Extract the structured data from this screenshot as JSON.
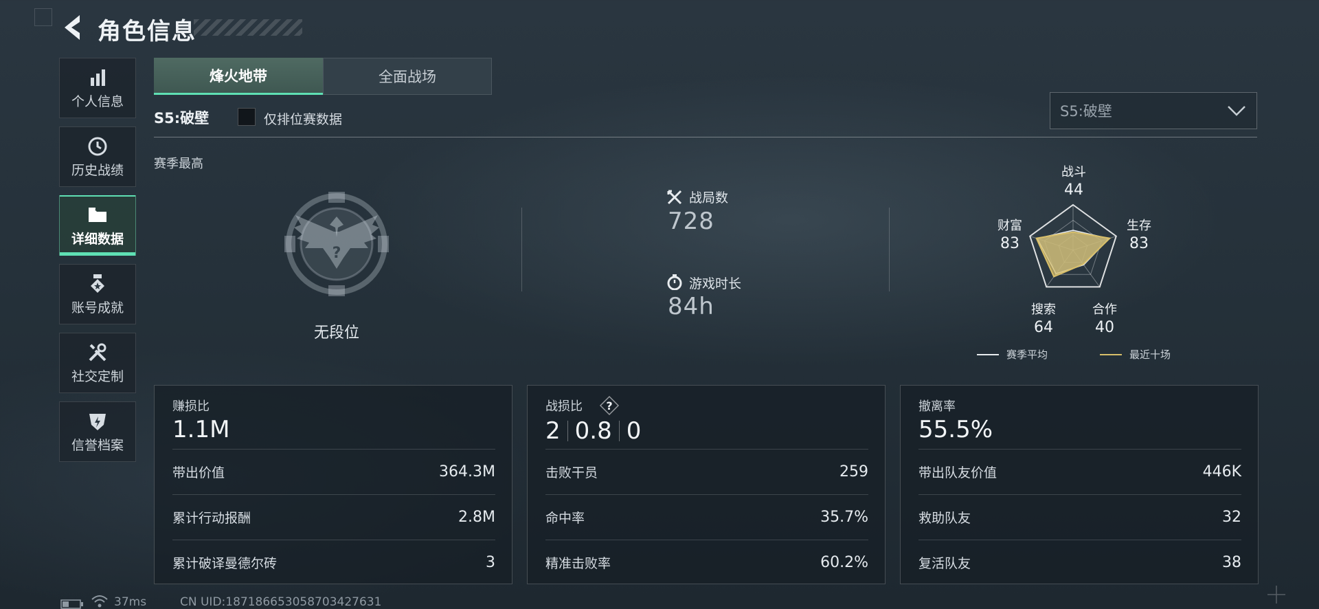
{
  "header": {
    "title": "角色信息"
  },
  "sidebar": {
    "items": [
      {
        "label": "个人信息"
      },
      {
        "label": "历史战绩"
      },
      {
        "label": "详细数据"
      },
      {
        "label": "账号成就"
      },
      {
        "label": "社交定制"
      },
      {
        "label": "信誉档案"
      }
    ]
  },
  "mode_tabs": [
    {
      "label": "烽火地带"
    },
    {
      "label": "全面战场"
    }
  ],
  "season": {
    "label": "S5:破壁",
    "ranked_only_label": "仅排位赛数据",
    "selected": "S5:破壁",
    "ranked_only_checked": false
  },
  "season_best": {
    "title": "赛季最高",
    "rank": "无段位"
  },
  "stats": {
    "matches_label": "战局数",
    "matches_value": "728",
    "playtime_label": "游戏时长",
    "playtime_value": "84h"
  },
  "radar": {
    "axes": [
      {
        "name": "战斗",
        "value": "44"
      },
      {
        "name": "生存",
        "value": "83"
      },
      {
        "name": "合作",
        "value": "40"
      },
      {
        "name": "搜索",
        "value": "64"
      },
      {
        "name": "财富",
        "value": "83"
      }
    ],
    "values_season_avg": [
      44,
      83,
      40,
      64,
      83
    ],
    "values_recent_ten": [
      40,
      85,
      38,
      72,
      85
    ],
    "legend": [
      {
        "name": "赛季平均",
        "color": "#e8ecef"
      },
      {
        "name": "最近十场",
        "color": "#d8bf6a"
      }
    ]
  },
  "cards": {
    "profit": {
      "title": "赚损比",
      "big": "1.1M",
      "rows": [
        {
          "k": "带出价值",
          "v": "364.3M"
        },
        {
          "k": "累计行动报酬",
          "v": "2.8M"
        },
        {
          "k": "累计破译曼德尔砖",
          "v": "3"
        }
      ]
    },
    "kd": {
      "title": "战损比",
      "help": "?",
      "values": [
        "2",
        "0.8",
        "0"
      ],
      "rows": [
        {
          "k": "击败干员",
          "v": "259"
        },
        {
          "k": "命中率",
          "v": "35.7%"
        },
        {
          "k": "精准击败率",
          "v": "60.2%"
        }
      ]
    },
    "extract": {
      "title": "撤离率",
      "big": "55.5%",
      "rows": [
        {
          "k": "带出队友价值",
          "v": "446K"
        },
        {
          "k": "救助队友",
          "v": "32"
        },
        {
          "k": "复活队友",
          "v": "38"
        }
      ]
    }
  },
  "footer": {
    "ping": "37ms",
    "uid": "CN UID:1871866530587034276​31"
  },
  "colors": {
    "accent": "#5fe0b4",
    "radar_gold": "#d8bf6a"
  }
}
